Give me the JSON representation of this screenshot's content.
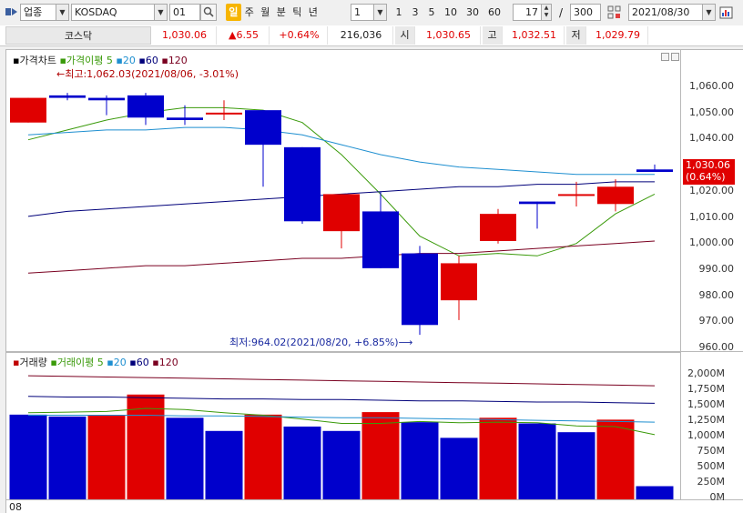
{
  "toolbar": {
    "market_type": "업종",
    "index_name": "KOSDAQ",
    "sector_code": "01",
    "period_tabs": [
      {
        "label": "일",
        "selected": true
      },
      {
        "label": "주",
        "selected": false
      },
      {
        "label": "월",
        "selected": false
      },
      {
        "label": "분",
        "selected": false
      },
      {
        "label": "틱",
        "selected": false
      },
      {
        "label": "년",
        "selected": false
      }
    ],
    "interval_value": "1",
    "interval_buttons": [
      "1",
      "3",
      "5",
      "10",
      "30",
      "60"
    ],
    "display_count": "17",
    "separator": "/",
    "total_count": "300",
    "date": "2021/08/30"
  },
  "info": {
    "name": "코스닥",
    "current": "1,030.06",
    "change": "▲6.55",
    "change_pct": "+0.64%",
    "volume": "216,036",
    "open_label": "시",
    "open": "1,030.65",
    "high_label": "고",
    "high": "1,032.51",
    "low_label": "저",
    "low": "1,029.79"
  },
  "price_panel": {
    "legend_title": "가격차트",
    "legend_ma_label": "가격이평",
    "ma_periods": [
      "5",
      "20",
      "60",
      "120"
    ],
    "high_annotation": "←최고:1,062.03(2021/08/06, -3.01%)",
    "low_annotation": "최저:964.02(2021/08/20, +6.85%)⟶",
    "current_price_label": "1,030.06",
    "current_pct_label": "(0.64%)",
    "y_ticks": [
      "1,060.00",
      "1,050.00",
      "1,040.00",
      "1,030.00",
      "1,020.00",
      "1,010.00",
      "1,000.00",
      "990.00",
      "980.00",
      "970.00",
      "960.00"
    ]
  },
  "volume_panel": {
    "legend_title": "거래량",
    "legend_ma_label": "거래이평",
    "ma_periods": [
      "5",
      "20",
      "60",
      "120"
    ],
    "y_ticks": [
      "2,000M",
      "1,750M",
      "1,500M",
      "1,250M",
      "1,000M",
      "750M",
      "500M",
      "250M",
      "0M"
    ],
    "x_label": "08"
  },
  "colors": {
    "up": "#e00000",
    "down": "#0000cc",
    "ma5": "#3a9a0a",
    "ma20": "#1e8fd0",
    "ma60": "#00007a",
    "ma120": "#7a0020",
    "accent": "#f7b500"
  },
  "chart_data": [
    {
      "type": "candlestick",
      "ylim": [
        960,
        1065
      ],
      "candles": [
        {
          "open": 1050,
          "high": 1060,
          "low": 1050,
          "close": 1060
        },
        {
          "open": 1061,
          "high": 1062,
          "low": 1059,
          "close": 1060
        },
        {
          "open": 1060,
          "high": 1061,
          "low": 1053,
          "close": 1059
        },
        {
          "open": 1061,
          "high": 1062,
          "low": 1049,
          "close": 1052
        },
        {
          "open": 1052,
          "high": 1057,
          "low": 1049,
          "close": 1051
        },
        {
          "open": 1054,
          "high": 1059,
          "low": 1051,
          "close": 1054
        },
        {
          "open": 1055,
          "high": 1055,
          "low": 1024,
          "close": 1041
        },
        {
          "open": 1040,
          "high": 1040,
          "low": 1009,
          "close": 1010
        },
        {
          "open": 1006,
          "high": 1021,
          "low": 999,
          "close": 1021
        },
        {
          "open": 1014,
          "high": 1022,
          "low": 991,
          "close": 991
        },
        {
          "open": 997,
          "high": 1000,
          "low": 964,
          "close": 968
        },
        {
          "open": 978,
          "high": 996,
          "low": 970,
          "close": 993
        },
        {
          "open": 1002,
          "high": 1015,
          "low": 1001,
          "close": 1013
        },
        {
          "open": 1018,
          "high": 1018,
          "low": 1007,
          "close": 1017
        },
        {
          "open": 1021,
          "high": 1026,
          "low": 1016,
          "close": 1021
        },
        {
          "open": 1017,
          "high": 1027,
          "low": 1014,
          "close": 1024
        },
        {
          "open": 1031,
          "high": 1033,
          "low": 1030,
          "close": 1030
        }
      ],
      "moving_averages": [
        {
          "name": "5",
          "values": [
            1043,
            1047,
            1051,
            1054,
            1056,
            1056,
            1055,
            1050,
            1037,
            1021,
            1004,
            996,
            997,
            996,
            1001,
            1013,
            1021
          ]
        },
        {
          "name": "20",
          "values": [
            1045,
            1046,
            1047,
            1047,
            1048,
            1048,
            1047,
            1045,
            1041,
            1037,
            1034,
            1032,
            1031,
            1030,
            1029,
            1029,
            1029
          ]
        },
        {
          "name": "60",
          "values": [
            1012,
            1014,
            1015,
            1016,
            1017,
            1018,
            1019,
            1020,
            1021,
            1022,
            1023,
            1024,
            1024,
            1025,
            1025,
            1026,
            1026
          ]
        },
        {
          "name": "120",
          "values": [
            989,
            990,
            991,
            992,
            992,
            993,
            994,
            995,
            995,
            996,
            997,
            997,
            998,
            999,
            1000,
            1001,
            1002
          ]
        }
      ]
    },
    {
      "type": "bar",
      "ylim": [
        0,
        2000
      ],
      "y_unit": "M",
      "values": [
        1350,
        1320,
        1340,
        1670,
        1300,
        1090,
        1350,
        1160,
        1090,
        1390,
        1230,
        980,
        1300,
        1210,
        1070,
        1270,
        210
      ],
      "up_flags": [
        false,
        false,
        true,
        true,
        false,
        false,
        true,
        false,
        false,
        true,
        false,
        false,
        true,
        false,
        false,
        true,
        false
      ],
      "moving_averages": [
        {
          "name": "5",
          "values": [
            1380,
            1390,
            1400,
            1450,
            1430,
            1380,
            1340,
            1280,
            1210,
            1210,
            1240,
            1220,
            1230,
            1220,
            1170,
            1160,
            1030
          ]
        },
        {
          "name": "20",
          "values": [
            1340,
            1340,
            1340,
            1340,
            1330,
            1330,
            1320,
            1310,
            1300,
            1300,
            1290,
            1280,
            1270,
            1260,
            1250,
            1240,
            1230
          ]
        },
        {
          "name": "60",
          "values": [
            1640,
            1630,
            1630,
            1620,
            1610,
            1600,
            1600,
            1590,
            1590,
            1580,
            1570,
            1570,
            1560,
            1550,
            1550,
            1540,
            1530
          ]
        },
        {
          "name": "120",
          "values": [
            1970,
            1960,
            1950,
            1940,
            1930,
            1920,
            1910,
            1900,
            1890,
            1880,
            1870,
            1860,
            1850,
            1840,
            1830,
            1820,
            1810
          ]
        }
      ]
    }
  ]
}
